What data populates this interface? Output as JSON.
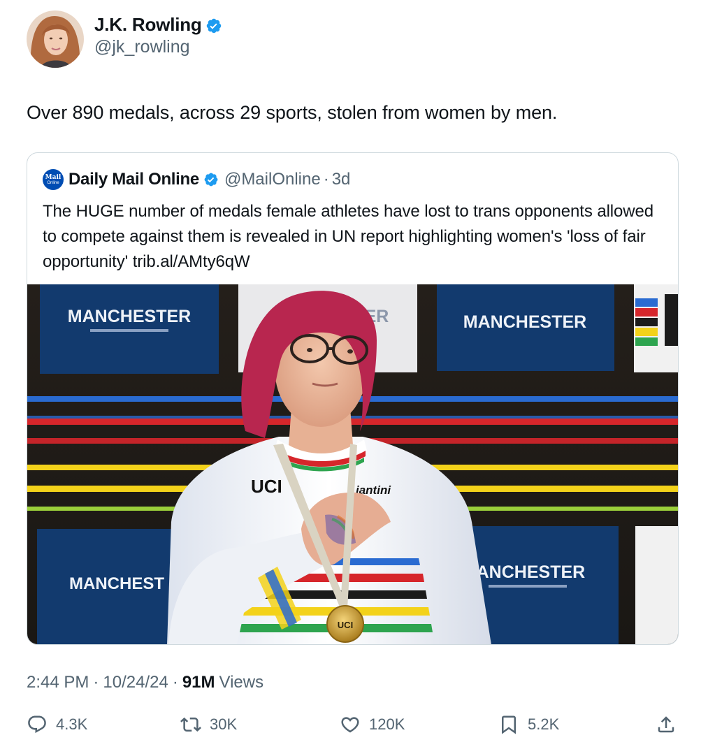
{
  "author": {
    "name": "J.K. Rowling",
    "handle": "@jk_rowling",
    "verified": true
  },
  "tweet": {
    "text": "Over 890 medals, across 29 sports, stolen from women by men."
  },
  "quoted_tweet": {
    "logo_text_line1": "Mail",
    "logo_text_line2": "Online",
    "name": "Daily Mail Online",
    "handle": "@MailOnline",
    "separator": "·",
    "time": "3d",
    "text": "The HUGE number of medals female athletes have lost to trans opponents allowed to compete against them is revealed in UN report highlighting women's 'loss of fair opportunity' trib.al/AMty6qW",
    "image": {
      "banner_text": "MANCHESTER",
      "banner_text_cut": "MANCHEST",
      "banner_partial": "ER",
      "jersey_logo": "UCI",
      "jersey_sponsor": "iantini",
      "medal_text": "UCI"
    }
  },
  "meta": {
    "time": "2:44 PM",
    "date": "10/24/24",
    "separator": "·",
    "views_count": "91M",
    "views_label": "Views"
  },
  "actions": {
    "replies": "4.3K",
    "retweets": "30K",
    "likes": "120K",
    "bookmarks": "5.2K"
  },
  "colors": {
    "text_primary": "#0f1419",
    "text_secondary": "#536471",
    "verified_blue": "#1d9bf0",
    "border": "#cfd9de",
    "mail_online_blue": "#004db3"
  },
  "icons": [
    "verified-badge-icon",
    "reply-icon",
    "retweet-icon",
    "like-icon",
    "bookmark-icon",
    "share-icon"
  ]
}
